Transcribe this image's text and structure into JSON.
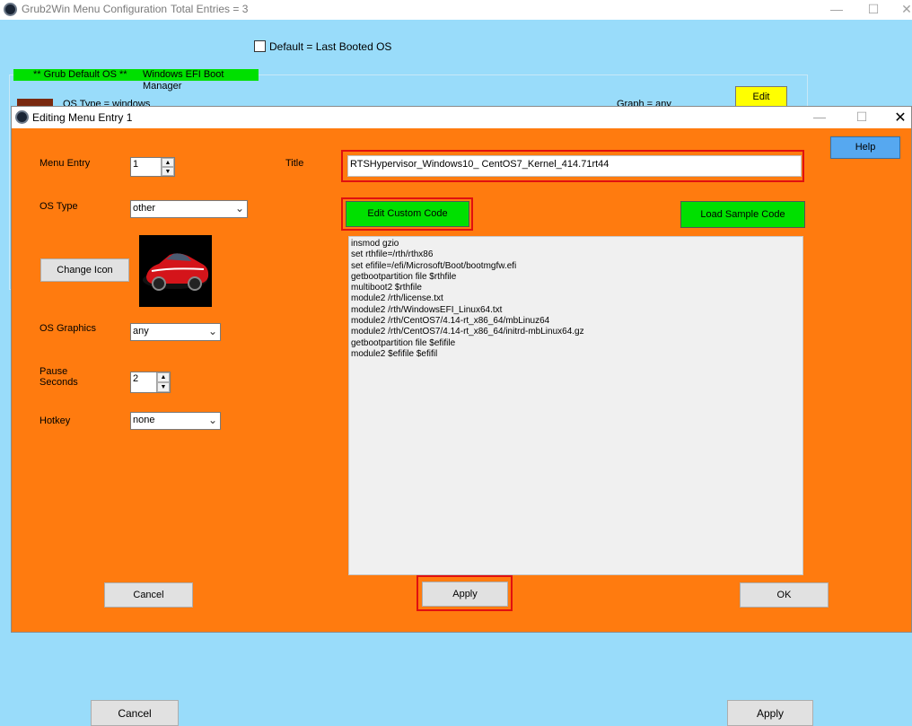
{
  "background_window": {
    "title": "Grub2Win Menu Configuration",
    "total_entries": "Total Entries = 3",
    "default_checkbox_label": "Default = Last Booted OS",
    "default_os_tag": "** Grub Default OS **",
    "boot_manager_label": "Windows EFI Boot Manager",
    "os_type_text": "OS Type = windows",
    "graph_text": "Graph = any",
    "edit_label": "Edit",
    "cancel_label": "Cancel",
    "apply_label": "Apply",
    "min_glyph": "—",
    "max_glyph": "☐",
    "close_glyph": "✕"
  },
  "dialog": {
    "title": "Editing Menu Entry 1",
    "min_glyph": "—",
    "max_glyph": "☐",
    "close_glyph": "✕",
    "help_label": "Help",
    "menu_entry_label": "Menu Entry",
    "menu_entry_value": "1",
    "title_label": "Title",
    "title_value": "RTSHypervisor_Windows10_ CentOS7_Kernel_414.71rt44",
    "os_type_label": "OS Type",
    "os_type_value": "other",
    "edit_custom_code_label": "Edit Custom Code",
    "load_sample_code_label": "Load Sample Code",
    "change_icon_label": "Change Icon",
    "os_graphics_label": "OS Graphics",
    "os_graphics_value": "any",
    "pause_label_1": "Pause",
    "pause_label_2": "Seconds",
    "pause_value": "2",
    "hotkey_label": "Hotkey",
    "hotkey_value": "none",
    "code_lines": "insmod gzio\nset rthfile=/rth/rthx86\nset efifile=/efi/Microsoft/Boot/bootmgfw.efi\ngetbootpartition file $rthfile\nmultiboot2 $rthfile\nmodule2 /rth/license.txt\nmodule2 /rth/WindowsEFI_Linux64.txt\nmodule2 /rth/CentOS7/4.14-rt_x86_64/mbLinuz64\nmodule2 /rth/CentOS7/4.14-rt_x86_64/initrd-mbLinux64.gz\ngetbootpartition file $efifile\nmodule2 $efifile $efifil",
    "cancel_label": "Cancel",
    "apply_label": "Apply",
    "ok_label": "OK"
  },
  "colors": {
    "dialog_bg": "#ff7b0f",
    "screen_bg": "#99dcfa",
    "green_button": "#00e000",
    "help_button": "#56a8f0",
    "highlight": "#e01010"
  }
}
